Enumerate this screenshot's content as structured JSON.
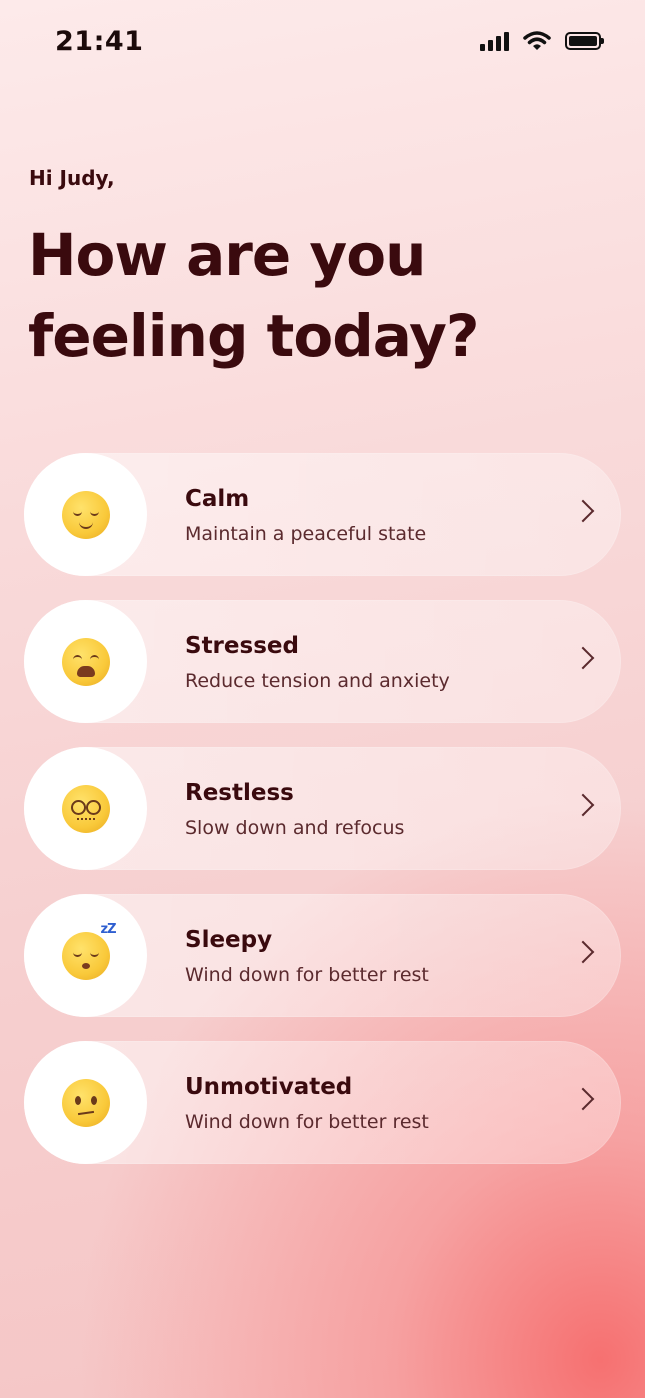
{
  "status_bar": {
    "time": "21:41",
    "icons": [
      "signal-icon",
      "wifi-icon",
      "battery-icon"
    ]
  },
  "greeting": "Hi Judy,",
  "headline_line1": "How are you",
  "headline_line2": "feeling today?",
  "colors": {
    "text_dark": "#3a0a0e",
    "accent_bottom": "#f66c6c",
    "card_bg": "#ffffff80"
  },
  "moods": [
    {
      "title": "Calm",
      "subtitle": "Maintain a peaceful state",
      "icon": "relieved-face-icon"
    },
    {
      "title": "Stressed",
      "subtitle": "Reduce tension and anxiety",
      "icon": "weary-face-icon"
    },
    {
      "title": "Restless",
      "subtitle": "Slow down and refocus",
      "icon": "face-with-spiral-eyes-icon"
    },
    {
      "title": "Sleepy",
      "subtitle": "Wind down for better rest",
      "icon": "sleeping-face-icon"
    },
    {
      "title": "Unmotivated",
      "subtitle": "Wind down for better rest",
      "icon": "confused-face-icon"
    }
  ]
}
